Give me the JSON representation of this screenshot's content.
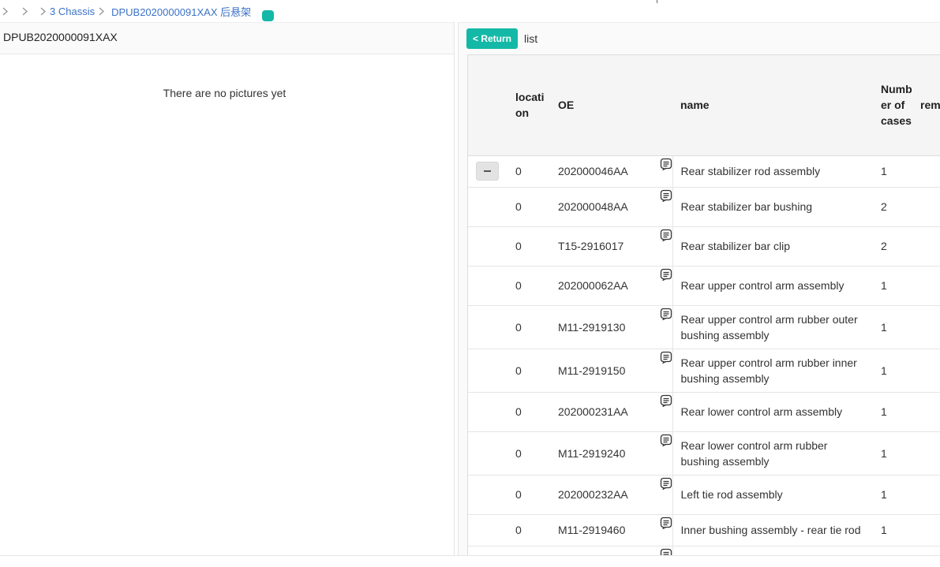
{
  "breadcrumb": {
    "items": [
      "3 Chassis",
      "DPUB2020000091XAX 后悬架"
    ]
  },
  "left_panel": {
    "title": "DPUB2020000091XAX",
    "empty_message": "There are no pictures yet"
  },
  "right_panel": {
    "return_label": "< Return",
    "title": "list",
    "columns": {
      "location": "location",
      "oe": "OE",
      "name": "name",
      "number_of_cases": "Number of cases",
      "remark": "rem"
    },
    "rows": [
      {
        "location": "0",
        "oe": "202000046AA",
        "name": "Rear stabilizer rod assembly",
        "count": "1"
      },
      {
        "location": "0",
        "oe": "202000048AA",
        "name": "Rear stabilizer bar bushing",
        "count": "2"
      },
      {
        "location": "0",
        "oe": "T15-2916017",
        "name": "Rear stabilizer bar clip",
        "count": "2"
      },
      {
        "location": "0",
        "oe": "202000062AA",
        "name": "Rear upper control arm assembly",
        "count": "1"
      },
      {
        "location": "0",
        "oe": "M11-2919130",
        "name": "Rear upper control arm rubber outer bushing assembly",
        "count": "1"
      },
      {
        "location": "0",
        "oe": "M11-2919150",
        "name": "Rear upper control arm rubber inner bushing assembly",
        "count": "1"
      },
      {
        "location": "0",
        "oe": "202000231AA",
        "name": "Rear lower control arm assembly",
        "count": "1"
      },
      {
        "location": "0",
        "oe": "M11-2919240",
        "name": "Rear lower control arm rubber bushing assembly",
        "count": "1"
      },
      {
        "location": "0",
        "oe": "202000232AA",
        "name": "Left tie rod assembly",
        "count": "1"
      },
      {
        "location": "0",
        "oe": "M11-2919460",
        "name": "Inner bushing assembly - rear tie rod",
        "count": "1"
      },
      {
        "location": "",
        "oe": "",
        "name": "",
        "count": ""
      }
    ]
  }
}
